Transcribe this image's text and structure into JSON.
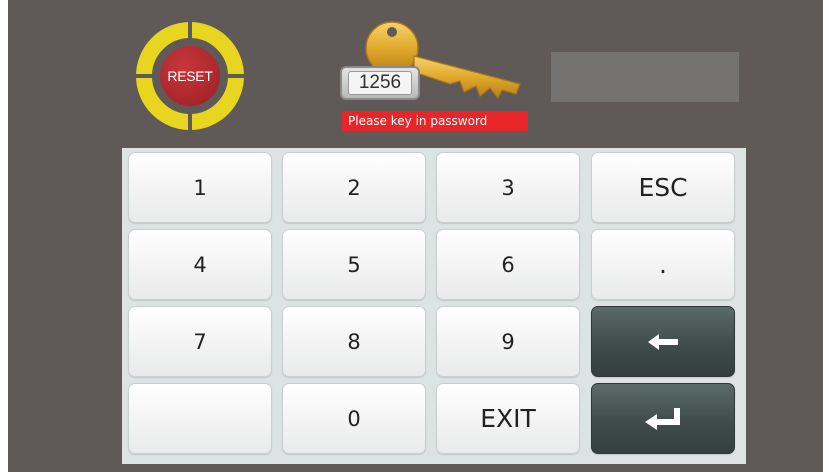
{
  "reset": {
    "label": "RESET"
  },
  "password": {
    "tag_value": "1256",
    "hint": "Please key in password",
    "field_value": ""
  },
  "keypad": {
    "k1": "1",
    "k2": "2",
    "k3": "3",
    "esc": "ESC",
    "k4": "4",
    "k5": "5",
    "k6": "6",
    "dot": ".",
    "k7": "7",
    "k8": "8",
    "k9": "9",
    "blank": "",
    "k0": "0",
    "exit": "EXIT"
  },
  "icons": {
    "backspace": "arrow-left-icon",
    "enter": "enter-return-icon"
  },
  "colors": {
    "background": "#5f5958",
    "keypad_bg": "#dde3e2",
    "reset_ring": "#e7d51f",
    "reset_center": "#a8262b",
    "hint_bg": "#e8262a",
    "dark_key": "#3f4c4a"
  }
}
